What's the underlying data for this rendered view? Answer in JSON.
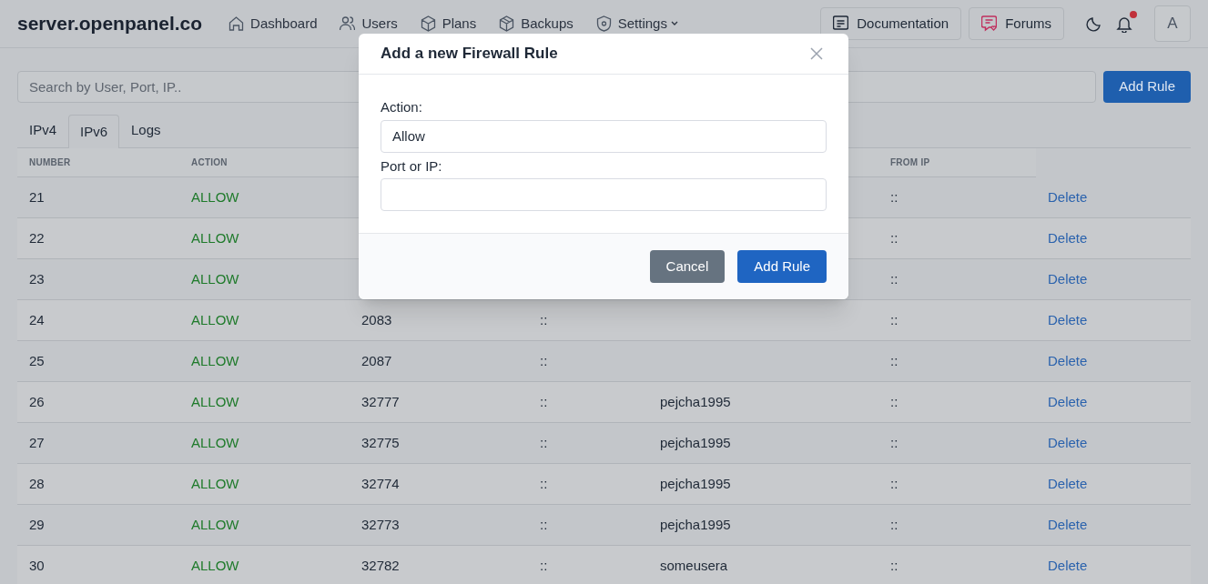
{
  "brand": "server.openpanel.co",
  "nav": [
    {
      "label": "Dashboard"
    },
    {
      "label": "Users"
    },
    {
      "label": "Plans"
    },
    {
      "label": "Backups"
    },
    {
      "label": "Settings",
      "caret": true
    }
  ],
  "header_buttons": [
    {
      "label": "Documentation"
    },
    {
      "label": "Forums"
    }
  ],
  "notifications": {
    "unread": true
  },
  "avatar": "A",
  "search": {
    "placeholder": "Search by User, Port, IP.."
  },
  "add_button": "Add Rule",
  "tabs": [
    {
      "label": "IPv4",
      "selected": false
    },
    {
      "label": "IPv6",
      "selected": true
    },
    {
      "label": "Logs",
      "selected": false
    }
  ],
  "table": {
    "columns": [
      "NUMBER",
      "ACTION",
      "",
      "",
      "",
      "FROM IP",
      ""
    ],
    "rows": [
      {
        "number": "21",
        "action": "ALLOW",
        "port": "",
        "to": "",
        "user": "",
        "from": "::",
        "delete": "Delete"
      },
      {
        "number": "22",
        "action": "ALLOW",
        "port": "",
        "to": "",
        "user": "",
        "from": "::",
        "delete": "Delete"
      },
      {
        "number": "23",
        "action": "ALLOW",
        "port": "",
        "to": "",
        "user": "",
        "from": "::",
        "delete": "Delete"
      },
      {
        "number": "24",
        "action": "ALLOW",
        "port": "2083",
        "to": "::",
        "user": "",
        "from": "::",
        "delete": "Delete"
      },
      {
        "number": "25",
        "action": "ALLOW",
        "port": "2087",
        "to": "::",
        "user": "",
        "from": "::",
        "delete": "Delete"
      },
      {
        "number": "26",
        "action": "ALLOW",
        "port": "32777",
        "to": "::",
        "user": "pejcha1995",
        "from": "::",
        "delete": "Delete"
      },
      {
        "number": "27",
        "action": "ALLOW",
        "port": "32775",
        "to": "::",
        "user": "pejcha1995",
        "from": "::",
        "delete": "Delete"
      },
      {
        "number": "28",
        "action": "ALLOW",
        "port": "32774",
        "to": "::",
        "user": "pejcha1995",
        "from": "::",
        "delete": "Delete"
      },
      {
        "number": "29",
        "action": "ALLOW",
        "port": "32773",
        "to": "::",
        "user": "pejcha1995",
        "from": "::",
        "delete": "Delete"
      },
      {
        "number": "30",
        "action": "ALLOW",
        "port": "32782",
        "to": "::",
        "user": "someusera",
        "from": "::",
        "delete": "Delete"
      }
    ]
  },
  "modal": {
    "title": "Add a new Firewall Rule",
    "fields": [
      {
        "label": "Action:",
        "value": "Allow"
      },
      {
        "label": "Port or IP:"
      }
    ],
    "buttons": [
      {
        "label": "Cancel",
        "kind": "secondary"
      },
      {
        "label": "Add Rule",
        "kind": "primary"
      }
    ]
  }
}
